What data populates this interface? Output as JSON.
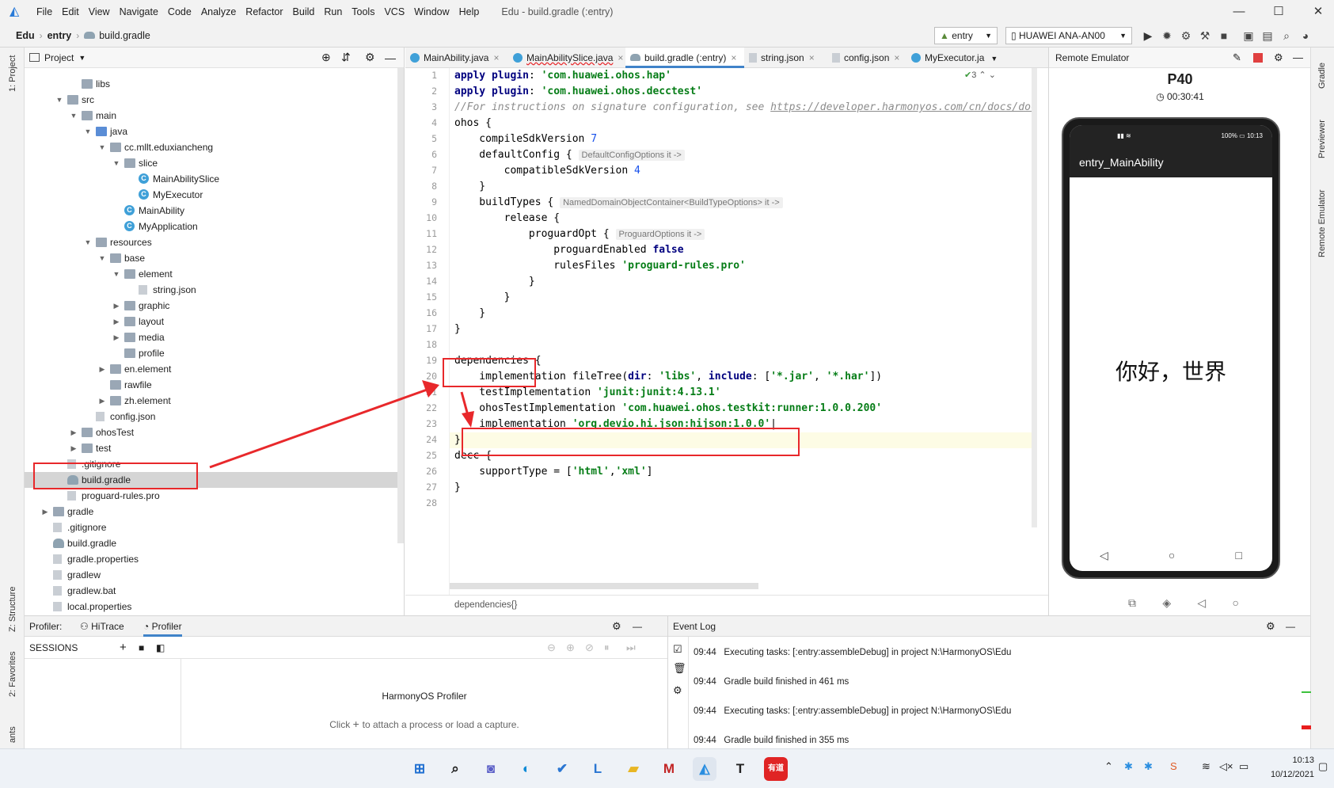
{
  "window": {
    "title": "Edu - build.gradle (:entry)",
    "menu": [
      "File",
      "Edit",
      "View",
      "Navigate",
      "Code",
      "Analyze",
      "Refactor",
      "Build",
      "Run",
      "Tools",
      "VCS",
      "Window",
      "Help"
    ]
  },
  "navbar": {
    "crumbs": [
      "Edu",
      "entry",
      "build.gradle"
    ],
    "run_config": "entry",
    "device": "HUAWEI ANA-AN00"
  },
  "left_stripe": {
    "project": "1: Project",
    "structure": "Z: Structure",
    "favorites": "2: Favorites",
    "build_variants": "ants"
  },
  "right_stripe": {
    "gradle": "Gradle",
    "previewer": "Previewer",
    "remote_emulator": "Remote Emulator"
  },
  "project_panel": {
    "title": "Project",
    "tree": [
      {
        "label": "libs",
        "depth": 3,
        "type": "folder",
        "arrow": ""
      },
      {
        "label": "src",
        "depth": 2,
        "type": "folder",
        "arrow": "down"
      },
      {
        "label": "main",
        "depth": 3,
        "type": "folder",
        "arrow": "down"
      },
      {
        "label": "java",
        "depth": 4,
        "type": "folder-blue",
        "arrow": "down"
      },
      {
        "label": "cc.mllt.eduxiancheng",
        "depth": 5,
        "type": "folder",
        "arrow": "down"
      },
      {
        "label": "slice",
        "depth": 6,
        "type": "folder",
        "arrow": "down"
      },
      {
        "label": "MainAbilitySlice",
        "depth": 7,
        "type": "class",
        "arrow": ""
      },
      {
        "label": "MyExecutor",
        "depth": 7,
        "type": "class",
        "arrow": ""
      },
      {
        "label": "MainAbility",
        "depth": 6,
        "type": "class",
        "arrow": ""
      },
      {
        "label": "MyApplication",
        "depth": 6,
        "type": "class",
        "arrow": ""
      },
      {
        "label": "resources",
        "depth": 4,
        "type": "folder",
        "arrow": "down"
      },
      {
        "label": "base",
        "depth": 5,
        "type": "folder",
        "arrow": "down"
      },
      {
        "label": "element",
        "depth": 6,
        "type": "folder",
        "arrow": "down"
      },
      {
        "label": "string.json",
        "depth": 7,
        "type": "file",
        "arrow": ""
      },
      {
        "label": "graphic",
        "depth": 6,
        "type": "folder",
        "arrow": "right"
      },
      {
        "label": "layout",
        "depth": 6,
        "type": "folder",
        "arrow": "right"
      },
      {
        "label": "media",
        "depth": 6,
        "type": "folder",
        "arrow": "right"
      },
      {
        "label": "profile",
        "depth": 6,
        "type": "folder",
        "arrow": ""
      },
      {
        "label": "en.element",
        "depth": 5,
        "type": "folder",
        "arrow": "right"
      },
      {
        "label": "rawfile",
        "depth": 5,
        "type": "folder",
        "arrow": ""
      },
      {
        "label": "zh.element",
        "depth": 5,
        "type": "folder",
        "arrow": "right"
      },
      {
        "label": "config.json",
        "depth": 4,
        "type": "file",
        "arrow": ""
      },
      {
        "label": "ohosTest",
        "depth": 3,
        "type": "folder",
        "arrow": "right"
      },
      {
        "label": "test",
        "depth": 3,
        "type": "folder",
        "arrow": "right"
      },
      {
        "label": ".gitignore",
        "depth": 2,
        "type": "file",
        "arrow": ""
      },
      {
        "label": "build.gradle",
        "depth": 2,
        "type": "gradle",
        "arrow": "",
        "selected": true
      },
      {
        "label": "proguard-rules.pro",
        "depth": 2,
        "type": "file",
        "arrow": ""
      },
      {
        "label": "gradle",
        "depth": 1,
        "type": "folder",
        "arrow": "right"
      },
      {
        "label": ".gitignore",
        "depth": 1,
        "type": "file",
        "arrow": ""
      },
      {
        "label": "build.gradle",
        "depth": 1,
        "type": "gradle",
        "arrow": ""
      },
      {
        "label": "gradle.properties",
        "depth": 1,
        "type": "file",
        "arrow": ""
      },
      {
        "label": "gradlew",
        "depth": 1,
        "type": "file",
        "arrow": ""
      },
      {
        "label": "gradlew.bat",
        "depth": 1,
        "type": "file",
        "arrow": ""
      },
      {
        "label": "local.properties",
        "depth": 1,
        "type": "file",
        "arrow": ""
      }
    ]
  },
  "editor": {
    "tabs": [
      {
        "label": "MainAbility.java",
        "icon": "class"
      },
      {
        "label": "MainAbilitySlice.java",
        "icon": "class"
      },
      {
        "label": "build.gradle (:entry)",
        "icon": "gradle",
        "active": true
      },
      {
        "label": "string.json",
        "icon": "file"
      },
      {
        "label": "config.json",
        "icon": "file"
      },
      {
        "label": "MyExecutor.ja",
        "icon": "class"
      }
    ],
    "inspection_count": "3",
    "breadcrumb": "dependencies{}",
    "current_line": 23
  },
  "emulator": {
    "title": "Remote Emulator",
    "device_name": "P40",
    "timer": "00:30:41",
    "status_time": "10:13",
    "status_battery": "100%",
    "app_title": "entry_MainAbility",
    "content_text": "你好，世界"
  },
  "profiler": {
    "label": "Profiler:",
    "tabs": [
      "HiTrace",
      "Profiler"
    ],
    "sessions": "SESSIONS",
    "center_title": "HarmonyOS Profiler",
    "hint_prefix": "Click",
    "hint_suffix": "to attach a process or load a capture."
  },
  "event_log": {
    "title": "Event Log",
    "entries": [
      {
        "time": "09:44",
        "text": "Executing tasks: [:entry:assembleDebug] in project N:\\HarmonyOS\\Edu"
      },
      {
        "time": "09:44",
        "text": "Gradle build finished in 461 ms"
      },
      {
        "time": "09:44",
        "text": "Executing tasks: [:entry:assembleDebug] in project N:\\HarmonyOS\\Edu"
      },
      {
        "time": "09:44",
        "text": "Gradle build finished in 355 ms"
      }
    ]
  },
  "taskbar": {
    "clock_time": "10:13",
    "clock_date": "10/12/2021"
  },
  "colors": {
    "accent": "#4083c9",
    "annotation": "#e8282b",
    "string": "#067d17",
    "keyword": "#00007f"
  }
}
